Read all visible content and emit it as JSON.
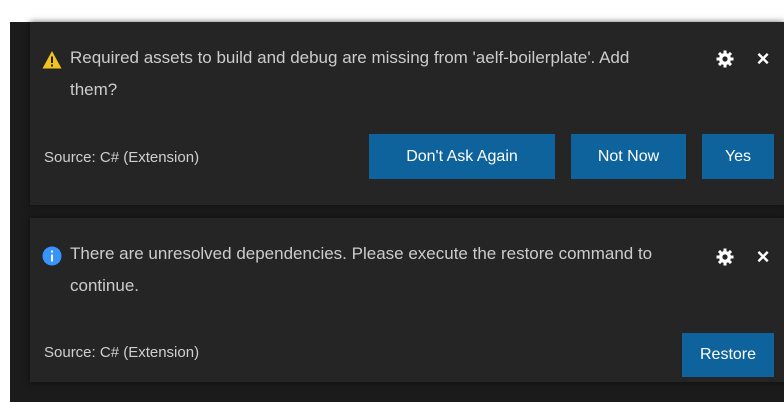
{
  "notifications": [
    {
      "severity": "warning",
      "icon": "warning-icon",
      "message": "Required assets to build and debug are missing from 'aelf-boilerplate'. Add them?",
      "source": "Source: C# (Extension)",
      "buttons": [
        "Don't Ask Again",
        "Not Now",
        "Yes"
      ]
    },
    {
      "severity": "info",
      "icon": "info-icon",
      "message": "There are unresolved dependencies. Please execute the restore command to continue.",
      "source": "Source: C# (Extension)",
      "buttons": [
        "Restore"
      ]
    }
  ],
  "colors": {
    "toast_bg": "#252526",
    "button_bg": "#0e639c",
    "warning": "#f0c419",
    "info": "#3794ff"
  }
}
